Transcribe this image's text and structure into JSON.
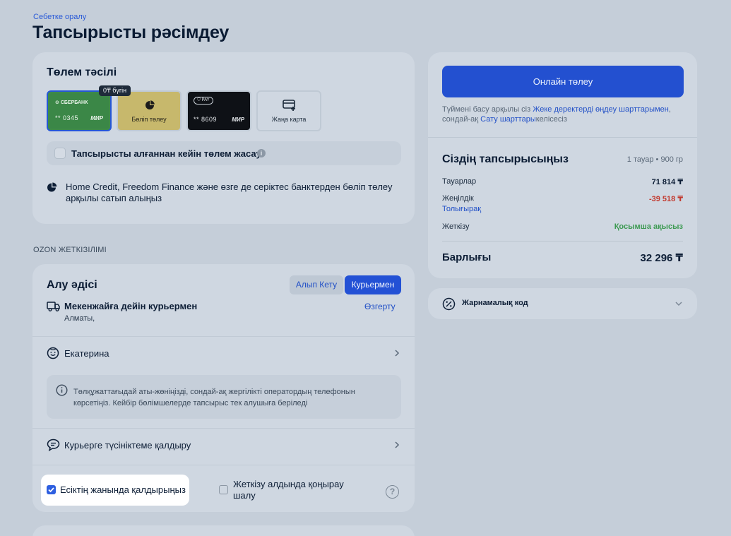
{
  "header": {
    "back_link": "Себетке оралу",
    "title": "Тапсырысты рәсімдеу"
  },
  "payment": {
    "title": "Төлем тәсілі",
    "cards": [
      {
        "brand": "СБЕРБАНК",
        "number": "** 0345",
        "network": "МИР",
        "selected": true
      },
      {
        "label": "Бөліп төлеу",
        "tag": "0₸ бүгін"
      },
      {
        "brand": "PAY",
        "number": "** 8609",
        "network": "МИР"
      },
      {
        "label": "Жаңа карта"
      }
    ],
    "pay_later_label": "Тапсырысты алғаннан кейін төлем жасау",
    "installment_text": "Home Credit, Freedom Finance және өзге де серіктес банктерден бөліп төлеу арқылы сатып алыңыз"
  },
  "delivery": {
    "section_label": "OZON ЖЕТКІЗІЛІМІ",
    "title": "Алу әдісі",
    "tabs": [
      {
        "label": "Алып Кету",
        "active": false
      },
      {
        "label": "Курьермен",
        "active": true
      }
    ],
    "courier_title": "Мекенжайға дейін курьермен",
    "city": "Алматы,",
    "change_label": "Өзгерту",
    "recipient": "Екатерина",
    "notice": "Төлқұжаттағыдай аты-жөніңізді, сондай-ақ жергілікті оператордың телефонын көрсетіңіз. Кейбір бөлімшелерде тапсырыс тек алушыға беріледі",
    "comment_label": "Курьерге түсініктеме қалдыру",
    "leave_at_door": {
      "label": "Есіктің жанында қалдырыңыз",
      "checked": true
    },
    "call_before": {
      "label": "Жеткізу алдында қоңырау шалу",
      "checked": false
    }
  },
  "summary": {
    "pay_button": "Онлайн төлеу",
    "terms_prefix": "Түймені басу арқылы сіз ",
    "terms_link1": "Жеке деректерді өңдеу шарттарымен",
    "terms_middle": ", сондай-ақ ",
    "terms_link2": "Сату шарттары",
    "terms_suffix": "келісесіз",
    "order_title": "Сіздің тапсырысыңыз",
    "order_meta": "1 тауар • 900 гр",
    "goods_label": "Тауарлар",
    "goods_value": "71 814 ₸",
    "discount_label": "Жеңілдік",
    "discount_value": "-39 518 ₸",
    "more_link": "Толығырақ",
    "shipping_label": "Жеткізу",
    "shipping_value": "Қосымша ақысыз",
    "total_label": "Барлығы",
    "total_value": "32 296 ₸"
  },
  "promo": {
    "label": "Жарнамалық код"
  },
  "colors": {
    "accent": "#2351d5",
    "discount": "#c23a2f",
    "free": "#3d9a52",
    "sber_green": "#3e8a4a",
    "installment_yellow": "#c7b86c"
  }
}
